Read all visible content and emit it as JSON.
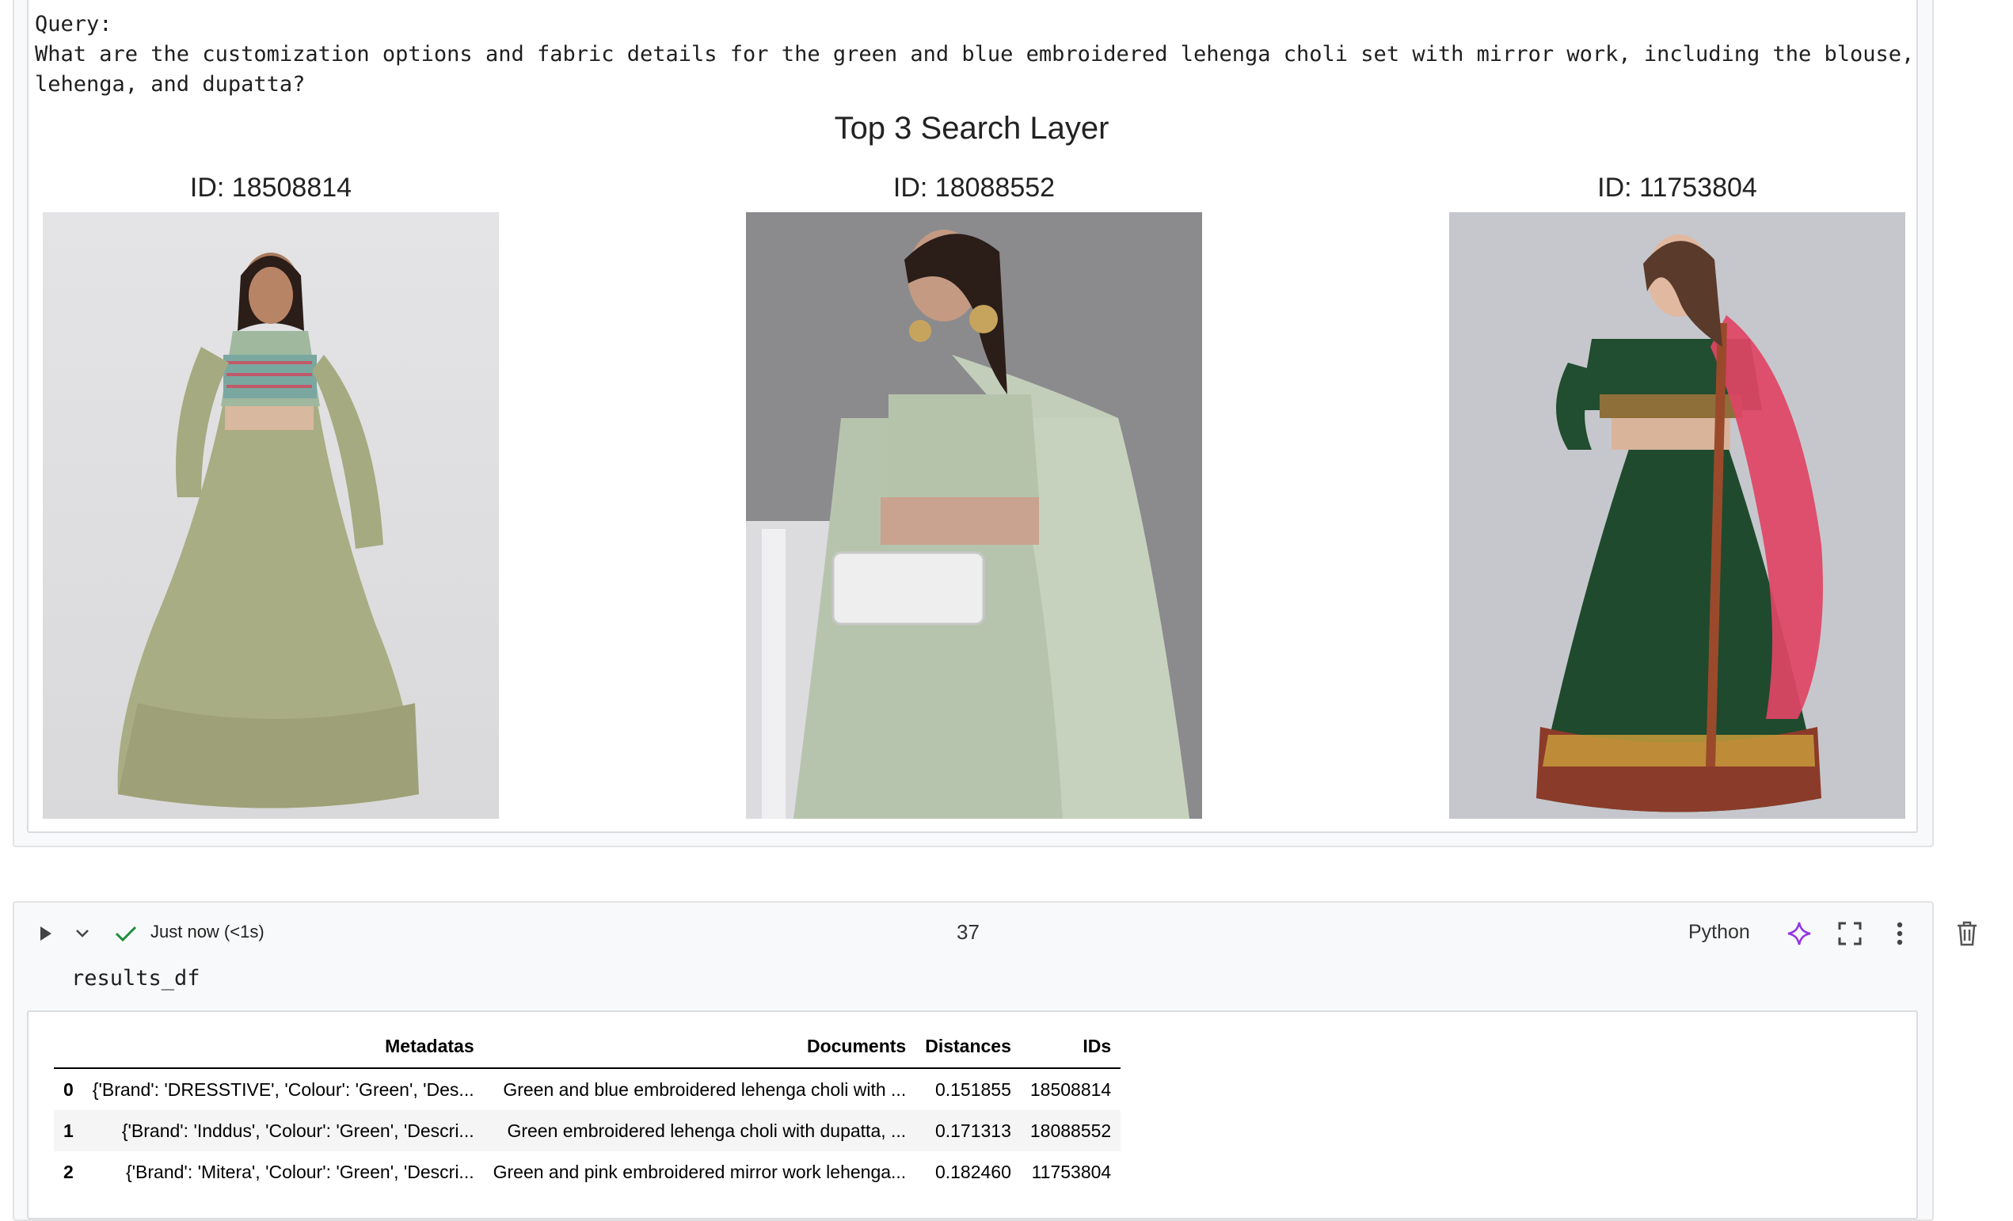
{
  "output_cell": {
    "query_label": "Query:",
    "query_text": "What are the customization options and fabric details for the green and blue embroidered lehenga choli set with mirror work, including the blouse, lehenga, and dupatta?",
    "figure_title": "Top 3 Search Layer",
    "results": [
      {
        "title": "ID: 18508814"
      },
      {
        "title": "ID: 18088552"
      },
      {
        "title": "ID: 11753804"
      }
    ]
  },
  "code_cell": {
    "status": "Just now (<1s)",
    "execution_count": "37",
    "language": "Python",
    "source": "results_df",
    "icons": [
      "run-icon",
      "chevron-down-icon",
      "check-icon",
      "sparkle-icon",
      "expand-icon",
      "more-vert-icon",
      "trash-icon"
    ],
    "colors": {
      "check": "#1e8e3e",
      "sparkle": "#9334e6"
    }
  },
  "dataframe": {
    "columns": [
      "",
      "Metadatas",
      "Documents",
      "Distances",
      "IDs"
    ],
    "rows": [
      {
        "index": "0",
        "metadatas": "{'Brand': 'DRESSTIVE', 'Colour': 'Green', 'Des...",
        "documents": "Green and blue embroidered lehenga choli with ...",
        "distances": "0.151855",
        "ids": "18508814"
      },
      {
        "index": "1",
        "metadatas": "{'Brand': 'Inddus', 'Colour': 'Green', 'Descri...",
        "documents": "Green embroidered lehenga choli with dupatta, ...",
        "distances": "0.171313",
        "ids": "18088552"
      },
      {
        "index": "2",
        "metadatas": "{'Brand': 'Mitera', 'Colour': 'Green', 'Descri...",
        "documents": "Green and pink embroidered mirror work lehenga...",
        "distances": "0.182460",
        "ids": "11753804"
      }
    ]
  }
}
